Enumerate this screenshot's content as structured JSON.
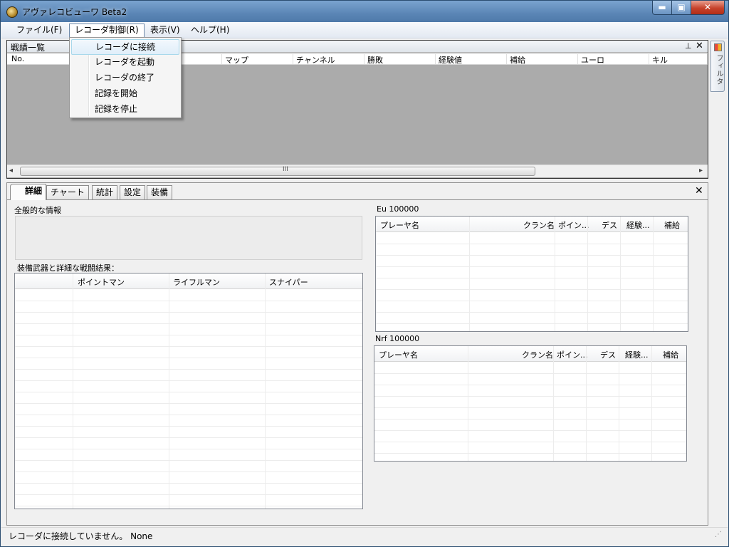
{
  "window": {
    "title": "アヴァレコビューワ  Beta2",
    "min": "▬",
    "max": "▣",
    "close": "✕"
  },
  "menu": [
    {
      "label": "ファイル(F)"
    },
    {
      "label": "レコーダ制御(R)"
    },
    {
      "label": "表示(V)"
    },
    {
      "label": "ヘルプ(H)"
    }
  ],
  "dropdown": [
    {
      "label": "レコーダに接続"
    },
    {
      "label": "レコーダを起動"
    },
    {
      "label": "レコーダの終了"
    },
    {
      "label": "記録を開始"
    },
    {
      "label": "記録を停止"
    }
  ],
  "battle_list": {
    "title": "戦績一覧",
    "pin": "📌",
    "close": "✕",
    "columns": [
      "No.",
      "マップ",
      "チャンネル",
      "勝敗",
      "経験値",
      "補給",
      "ユーロ",
      "キル"
    ],
    "scroll_grip": "III",
    "scroll_left": "◂",
    "scroll_right": "▸"
  },
  "filter_tab": {
    "label": "フィルタ"
  },
  "tabs": [
    {
      "label": "詳細"
    },
    {
      "label": "チャート"
    },
    {
      "label": "統計"
    },
    {
      "label": "設定"
    },
    {
      "label": "装備"
    }
  ],
  "tab_close": "✕",
  "details": {
    "general_label": "全般的な情報",
    "weapons_label": "装備武器と詳細な戦闘結果：",
    "weapon_columns": [
      "",
      "ポイントマン",
      "ライフルマン",
      "スナイパー"
    ],
    "eu_label": "Eu  100000",
    "nrf_label": "Nrf  100000",
    "player_columns": [
      "プレーヤ名",
      "クラン名",
      "ポイン...",
      "デス",
      "経験...",
      "補給"
    ]
  },
  "status": {
    "text": "レコーダに接続していません。   None",
    "grip": "⋰"
  }
}
